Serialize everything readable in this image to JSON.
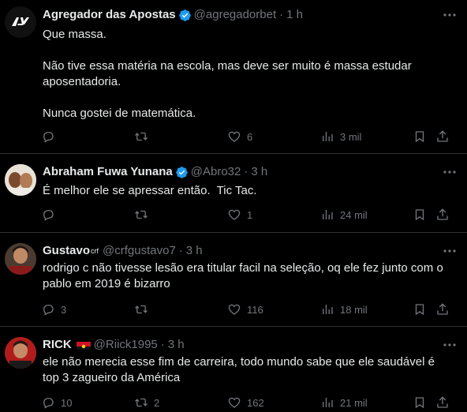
{
  "tweets": [
    {
      "name": "Agregador das Apostas",
      "handle": "@agregadorbet",
      "time": "1 h",
      "verified": true,
      "body": [
        "Que massa.",
        "",
        "Não tive essa matéria na escola, mas deve ser muito é massa estudar aposentadoria.",
        "",
        "Nunca gostei de matemática."
      ],
      "replies": "",
      "retweets": "",
      "likes": "6",
      "views": "3 mil"
    },
    {
      "name": "Abraham Fuwa Yunana",
      "handle": "@Abro32",
      "time": "3 h",
      "verified": true,
      "body": [
        "É melhor ele se apressar então.  Tic Tac."
      ],
      "replies": "",
      "retweets": "",
      "likes": "1",
      "views": "24 mil"
    },
    {
      "name": "Gustavo",
      "name_sup": "crf",
      "handle": "@crfgustavo7",
      "time": "3 h",
      "verified": false,
      "body": [
        "rodrigo c não tivesse lesão era titular facil na seleção, oq ele fez junto com o pablo em 2019 é bizarro"
      ],
      "replies": "3",
      "retweets": "",
      "likes": "116",
      "views": "18 mil"
    },
    {
      "name": "RICK",
      "handle": "@Riick1995",
      "time": "3 h",
      "verified": false,
      "flag": true,
      "body": [
        "ele não merecia esse fim de carreira, todo mundo sabe que ele saudável é top 3 zagueiro da América"
      ],
      "replies": "10",
      "retweets": "2",
      "likes": "162",
      "views": "21 mil"
    }
  ],
  "icons": {
    "reply": "reply-icon",
    "retweet": "retweet-icon",
    "like": "heart-icon",
    "views": "views-icon",
    "bookmark": "bookmark-icon",
    "share": "share-icon",
    "more": "more-icon",
    "verified": "verified-badge-icon"
  },
  "colors": {
    "background": "#000000",
    "text": "#e7e9ea",
    "muted": "#71767b",
    "verified": "#1d9bf0",
    "divider": "#2f3336"
  }
}
